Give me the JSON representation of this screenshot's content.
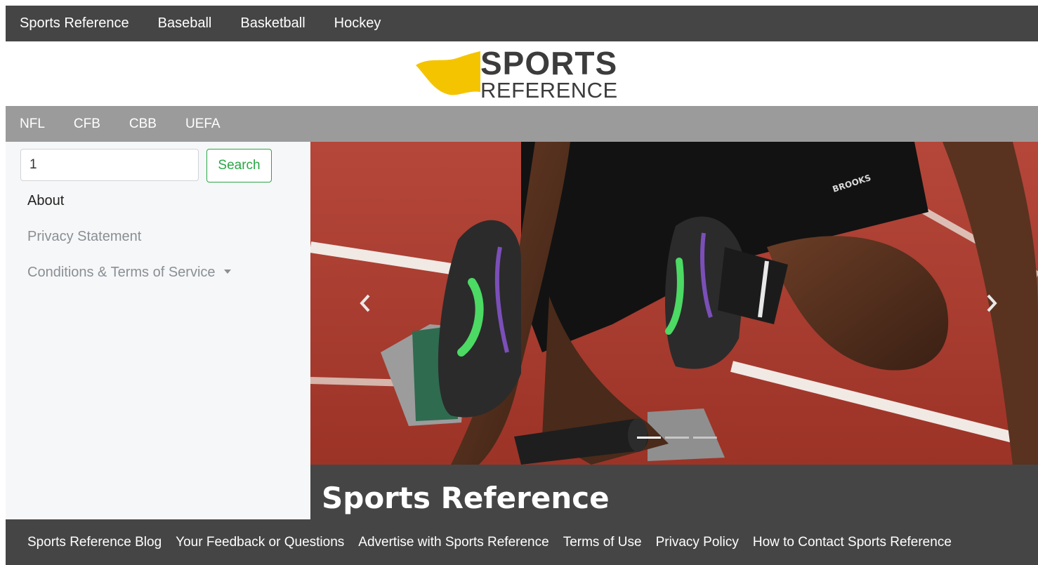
{
  "top_nav": {
    "items": [
      "Sports Reference",
      "Baseball",
      "Basketball",
      "Hockey"
    ]
  },
  "logo": {
    "line1": "SPORTS",
    "line2": "REFERENCE",
    "flag_color": "#f5c400",
    "text_color": "#3c3c3c"
  },
  "sub_nav": {
    "items": [
      "NFL",
      "CFB",
      "CBB",
      "UEFA"
    ]
  },
  "sidebar": {
    "search": {
      "value": "1",
      "button_label": "Search"
    },
    "links": [
      {
        "label": "About",
        "state": "active"
      },
      {
        "label": "Privacy Statement",
        "state": "muted"
      },
      {
        "label": "Conditions & Terms of Service",
        "state": "muted",
        "has_dropdown": true
      }
    ]
  },
  "carousel": {
    "slide_count": 3,
    "active_index": 0,
    "prev_icon": "chevron-left-icon",
    "next_icon": "chevron-right-icon",
    "shoe_brand": "BROOKS",
    "caption": "Sports Reference"
  },
  "footer": {
    "links": [
      "Sports Reference Blog",
      "Your Feedback or Questions",
      "Advertise with Sports Reference",
      "Terms of Use",
      "Privacy Policy",
      "How to Contact Sports Reference"
    ]
  },
  "colors": {
    "nav_bg": "#454545",
    "subnav_bg": "#9b9b9b",
    "sidebar_bg": "#f6f7f8",
    "search_accent": "#28a745",
    "track_red": "#a8392b"
  }
}
